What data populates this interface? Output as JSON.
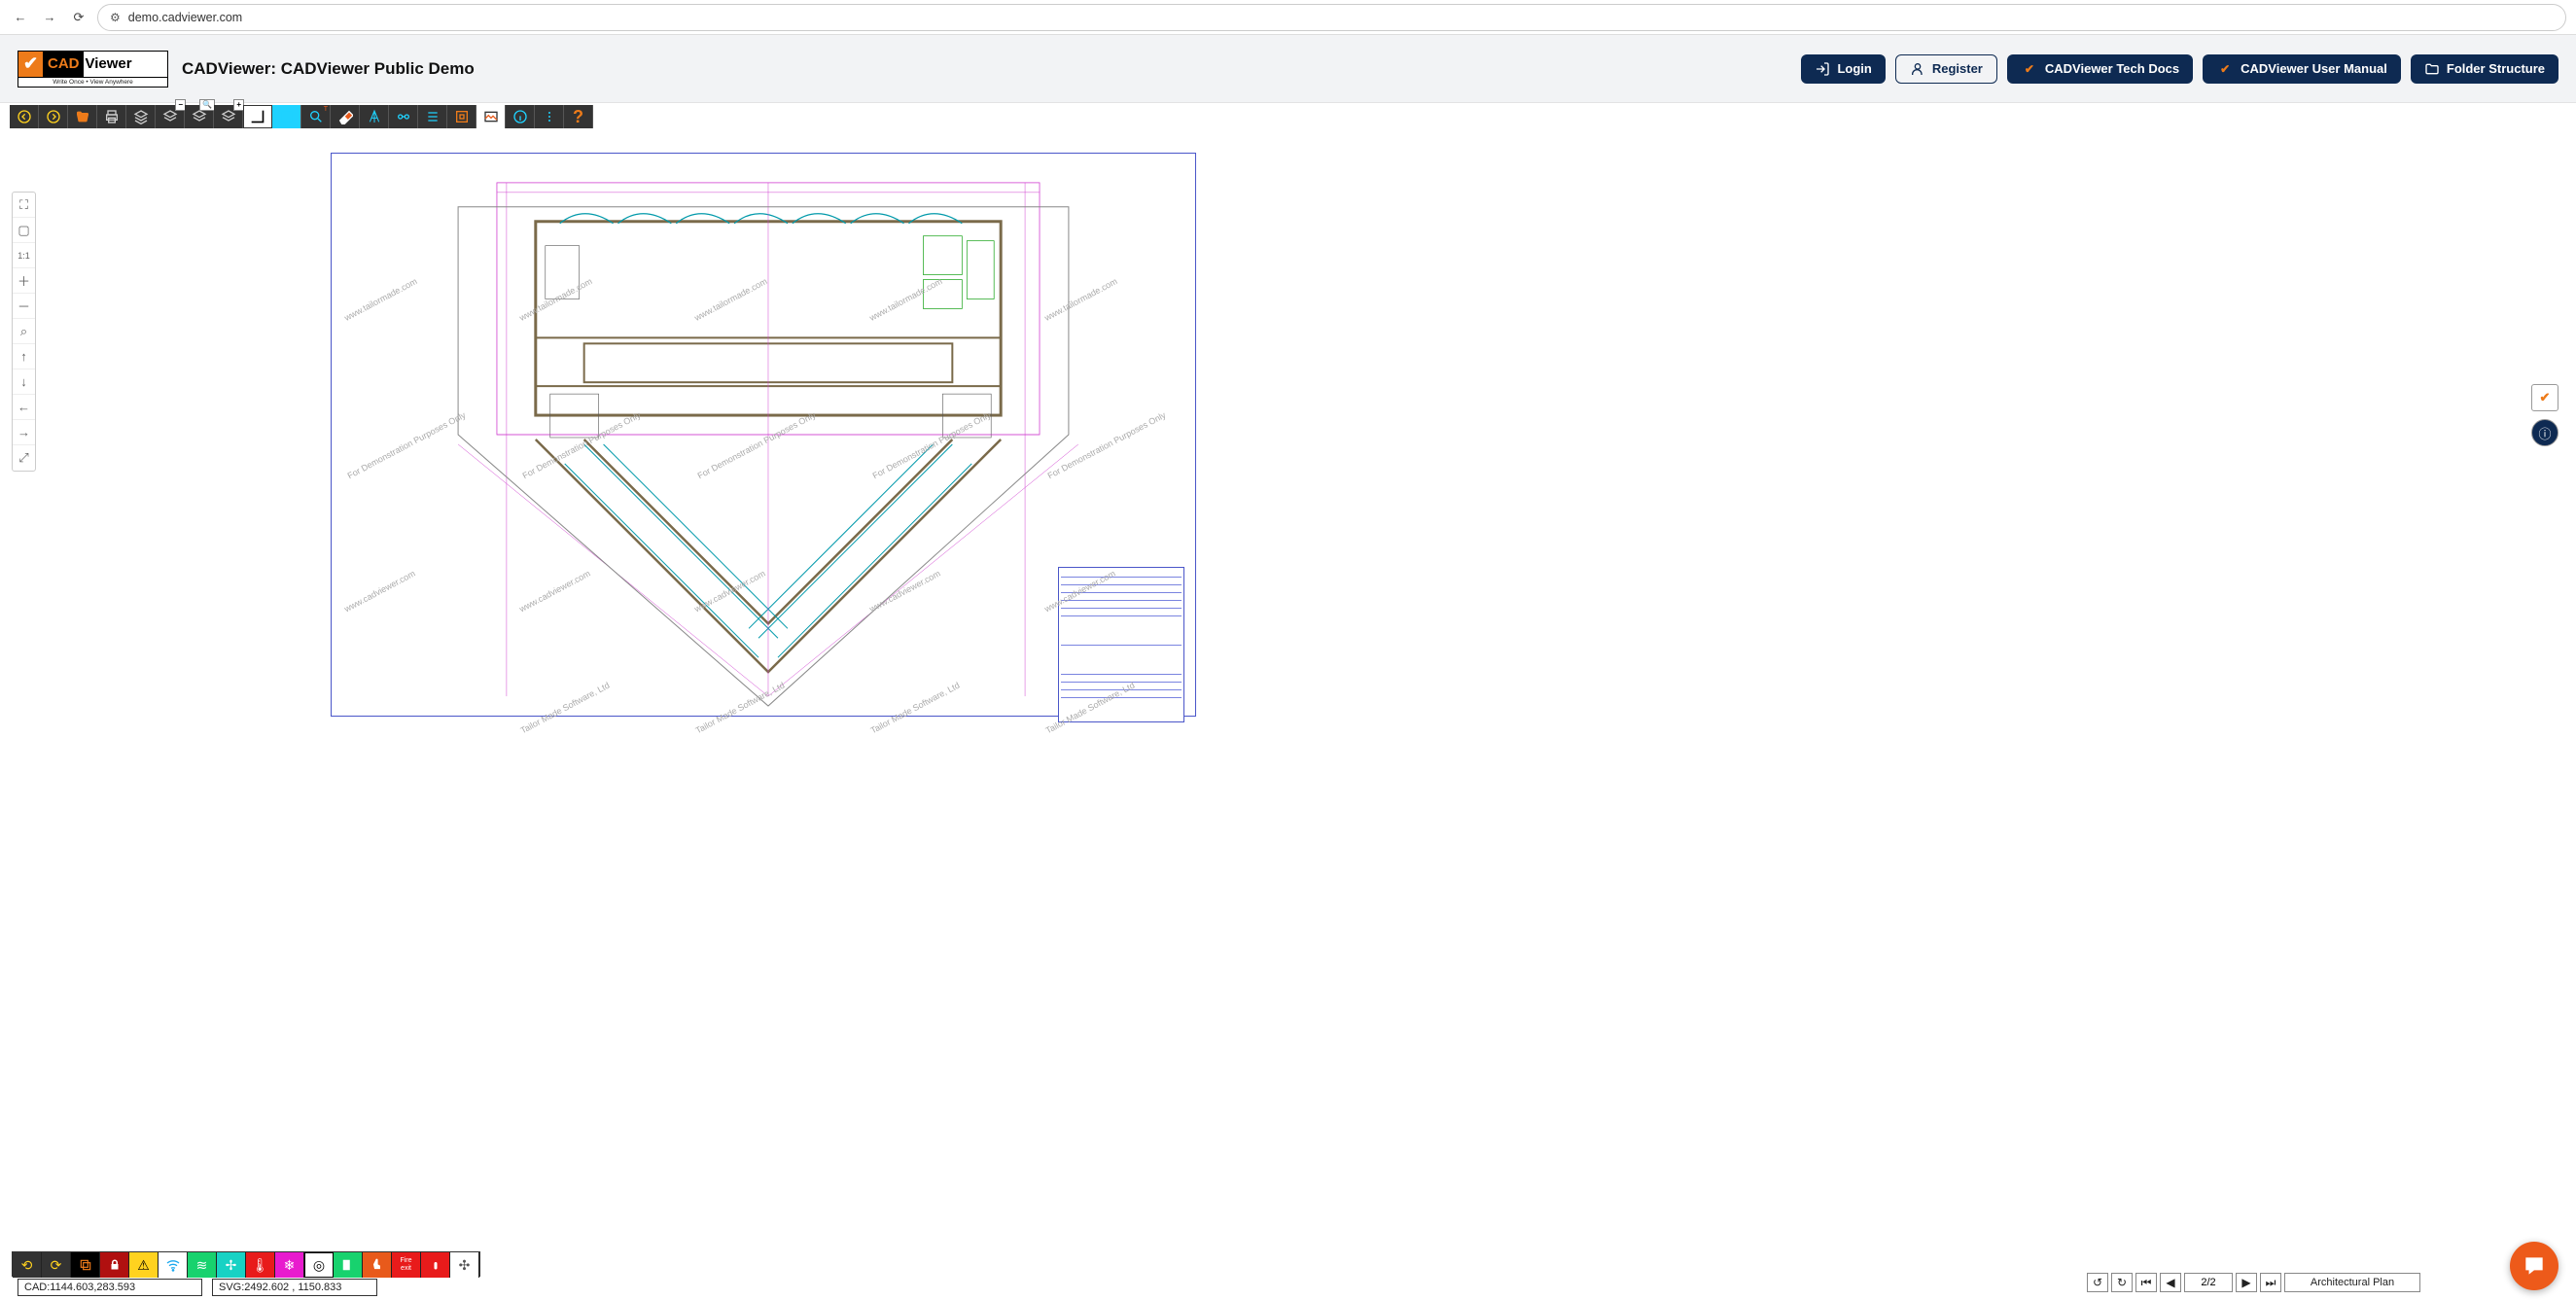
{
  "browser": {
    "url": "demo.cadviewer.com"
  },
  "header": {
    "logo_cad": "CAD",
    "logo_viewer": "Viewer",
    "logo_sub": "Write Once • View Anywhere",
    "title": "CADViewer: CADViewer Public Demo",
    "buttons": {
      "login": "Login",
      "register": "Register",
      "tech_docs": "CADViewer Tech Docs",
      "user_manual": "CADViewer User Manual",
      "folder": "Folder Structure"
    }
  },
  "toolbar_top": {
    "badges": {
      "layers_minus": "−",
      "layers_find": "🔍",
      "layers_plus": "+"
    }
  },
  "coords": {
    "cad_label": "CAD: ",
    "cad_value": "1144.603,283.593",
    "svg_label": "SVG: ",
    "svg_value": "2492.602 , 1150.833"
  },
  "pager": {
    "value": "2/2",
    "view_name": "Architectural Plan"
  },
  "watermarks": {
    "demo": "For Demonstration Purposes Only",
    "tm": "Tailor Made Software, Ltd",
    "cv": "www.cadviewer.com",
    "tmw": "www.tailormade.com"
  },
  "layer_colors": [
    "#333",
    "#333",
    "#000",
    "#c02020",
    "#ffd21f",
    "#fff",
    "#18d26e",
    "#18d2c4",
    "#1aa8ee",
    "#e81b1b",
    "#e81bce",
    "#e81b1b",
    "#fff",
    "#18d26e",
    "#e85a1b",
    "#e81b1b",
    "#e81b1b",
    "#fff",
    "#999"
  ]
}
